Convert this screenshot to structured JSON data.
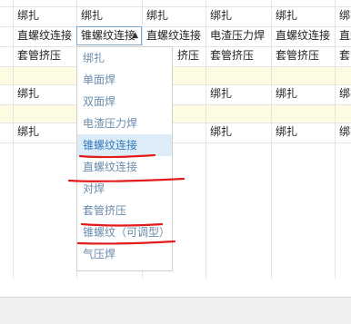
{
  "rows": [
    [
      "绑扎",
      "绑扎",
      "绑扎",
      "绑扎",
      "绑扎",
      "绑扎"
    ],
    [
      "直螺纹连接",
      "",
      "直螺纹连接",
      "电渣压力焊",
      "直螺纹连接",
      "直螺"
    ],
    [
      "套管挤压",
      "",
      "挤压",
      "套管挤压",
      "套管挤压",
      "套管"
    ],
    [
      "",
      "",
      "",
      "",
      "",
      ""
    ],
    [
      "绑扎",
      "",
      "",
      "绑扎",
      "绑扎",
      "绑扎"
    ],
    [
      "",
      "",
      "",
      "",
      "",
      ""
    ],
    [
      "绑扎",
      "",
      "",
      "绑扎",
      "绑扎",
      "绑扎"
    ]
  ],
  "editor": {
    "value": "锥螺纹连接",
    "arrow": "▲"
  },
  "dropdown": {
    "options": [
      "绑扎",
      "单面焊",
      "双面焊",
      "电渣压力焊",
      "锥螺纹连接",
      "直螺纹连接",
      "对焊",
      "套管挤压",
      "锥螺纹（可调型）",
      "气压焊"
    ],
    "selected_index": 4
  },
  "colors": {
    "highlight_row": "#fdfbe1",
    "selected_option": "#dcecf8",
    "annotation_red": "#e21b1b"
  }
}
